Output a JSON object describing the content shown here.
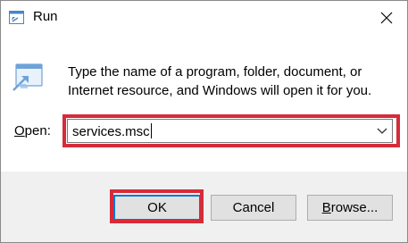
{
  "window": {
    "title": "Run",
    "description_line1": "Type the name of a program, folder, document, or",
    "description_line2": "Internet resource, and Windows will open it for you."
  },
  "open_field": {
    "label_accel": "O",
    "label_rest": "pen:",
    "value": "services.msc"
  },
  "buttons": {
    "ok": "OK",
    "cancel": "Cancel",
    "browse_accel": "B",
    "browse_rest": "rowse..."
  },
  "icons": {
    "title": "run-app-icon",
    "close": "close-icon",
    "dropdown": "chevron-down-icon"
  },
  "colors": {
    "highlight": "#d62b3a",
    "default_button_border": "#0078d7",
    "footer_bg": "#f0f0f0"
  }
}
